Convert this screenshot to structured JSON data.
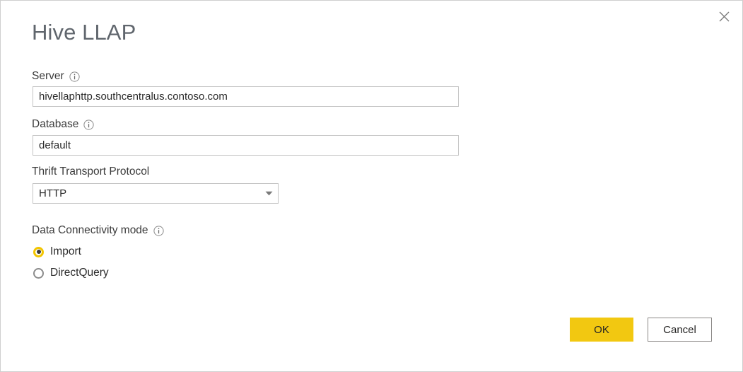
{
  "dialog": {
    "title": "Hive LLAP",
    "close_icon": "close-icon"
  },
  "fields": {
    "server": {
      "label": "Server",
      "info_icon": "info-icon",
      "value": "hivellaphttp.southcentralus.contoso.com",
      "placeholder": ""
    },
    "database": {
      "label": "Database",
      "info_icon": "info-icon",
      "value": "default",
      "placeholder": ""
    },
    "thrift_transport_protocol": {
      "label": "Thrift Transport Protocol",
      "value": "HTTP",
      "chevron_icon": "chevron-down-icon"
    }
  },
  "connectivity": {
    "label": "Data Connectivity mode",
    "info_icon": "info-icon",
    "options": [
      {
        "label": "Import",
        "selected": true
      },
      {
        "label": "DirectQuery",
        "selected": false
      }
    ]
  },
  "footer": {
    "ok_label": "OK",
    "cancel_label": "Cancel"
  },
  "colors": {
    "accent": "#f2c811",
    "radio_selected_ring": "#f2c500",
    "title_text": "#60666d",
    "border": "#c4c4c4",
    "dialog_border": "#cfcfcf"
  }
}
